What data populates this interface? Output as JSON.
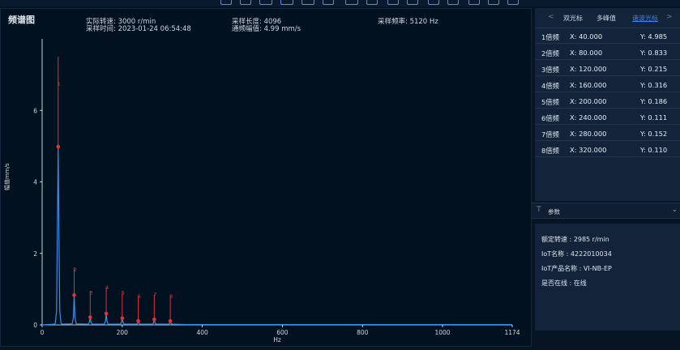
{
  "header": {
    "title": "频谱图",
    "speed": "实际转速: 3000 r/min",
    "time": "采样时间: 2023-01-24 06:54:48",
    "sample_length": "采样长度: 4096",
    "amplitude": "通频幅值: 4.99 mm/s",
    "sample_rate": "采样频率: 5120 Hz"
  },
  "tabs": {
    "prev": "<",
    "next": ">",
    "items": [
      "双光标",
      "多峰值",
      "谐波光标"
    ],
    "active_index": 2
  },
  "harmonics": [
    {
      "label": "1倍频",
      "x": "X: 40.000",
      "y": "Y: 4.985"
    },
    {
      "label": "2倍频",
      "x": "X: 80.000",
      "y": "Y: 0.833"
    },
    {
      "label": "3倍频",
      "x": "X: 120.000",
      "y": "Y: 0.215"
    },
    {
      "label": "4倍频",
      "x": "X: 160.000",
      "y": "Y: 0.316"
    },
    {
      "label": "5倍频",
      "x": "X: 200.000",
      "y": "Y: 0.186"
    },
    {
      "label": "6倍频",
      "x": "X: 240.000",
      "y": "Y: 0.111"
    },
    {
      "label": "7倍频",
      "x": "X: 280.000",
      "y": "Y: 0.152"
    },
    {
      "label": "8倍频",
      "x": "X: 320.000",
      "y": "Y: 0.110"
    }
  ],
  "params": {
    "title": "参数",
    "lines": [
      "额定转速 : 2985 r/min",
      "IoT名称 : 4222010034",
      "IoT产品名称 : VI-NB-EP",
      "是否在线 : 在线"
    ]
  },
  "colors": {
    "spectrum": "#3a8ee6",
    "cursor": "#e0323a"
  },
  "chart_data": {
    "type": "line",
    "xlabel": "Hz",
    "ylabel": "幅值mm/s",
    "xlim": [
      0,
      1174
    ],
    "ylim": [
      0,
      8
    ],
    "x_ticks": [
      0,
      200,
      400,
      600,
      800,
      1000,
      1174
    ],
    "y_ticks": [
      0,
      2,
      4,
      6
    ],
    "series": [
      {
        "x": [
          0,
          30,
          33,
          36,
          38,
          40,
          42,
          44,
          47,
          50,
          75,
          78,
          80,
          82,
          85,
          115,
          118,
          120,
          122,
          125,
          155,
          158,
          160,
          162,
          165,
          195,
          198,
          200,
          202,
          205,
          235,
          238,
          240,
          242,
          245,
          275,
          278,
          280,
          282,
          285,
          315,
          318,
          320,
          322,
          325,
          360,
          500,
          800,
          1174
        ],
        "y": [
          0,
          0.02,
          0.05,
          0.4,
          2.5,
          4.985,
          2.5,
          0.4,
          0.05,
          0.02,
          0.03,
          0.2,
          0.833,
          0.2,
          0.03,
          0.02,
          0.08,
          0.215,
          0.08,
          0.02,
          0.02,
          0.1,
          0.316,
          0.1,
          0.02,
          0.02,
          0.07,
          0.186,
          0.07,
          0.02,
          0.02,
          0.04,
          0.111,
          0.04,
          0.02,
          0.02,
          0.05,
          0.152,
          0.05,
          0.02,
          0.02,
          0.04,
          0.11,
          0.04,
          0.02,
          0.01,
          0.01,
          0.01,
          0.01
        ]
      }
    ],
    "cursors": {
      "labels": [
        "1",
        "2",
        "3",
        "4",
        "5",
        "6",
        "7",
        "8"
      ],
      "x": [
        40,
        80,
        120,
        160,
        200,
        240,
        280,
        320
      ],
      "y": [
        4.985,
        0.833,
        0.215,
        0.316,
        0.186,
        0.111,
        0.152,
        0.11
      ],
      "top": [
        7.5,
        1.6,
        0.95,
        1.05,
        0.9,
        0.8,
        0.85,
        0.8
      ],
      "label_y": [
        6.7,
        1.5,
        0.85,
        1.0,
        0.85,
        0.75,
        0.8,
        0.75
      ]
    }
  }
}
